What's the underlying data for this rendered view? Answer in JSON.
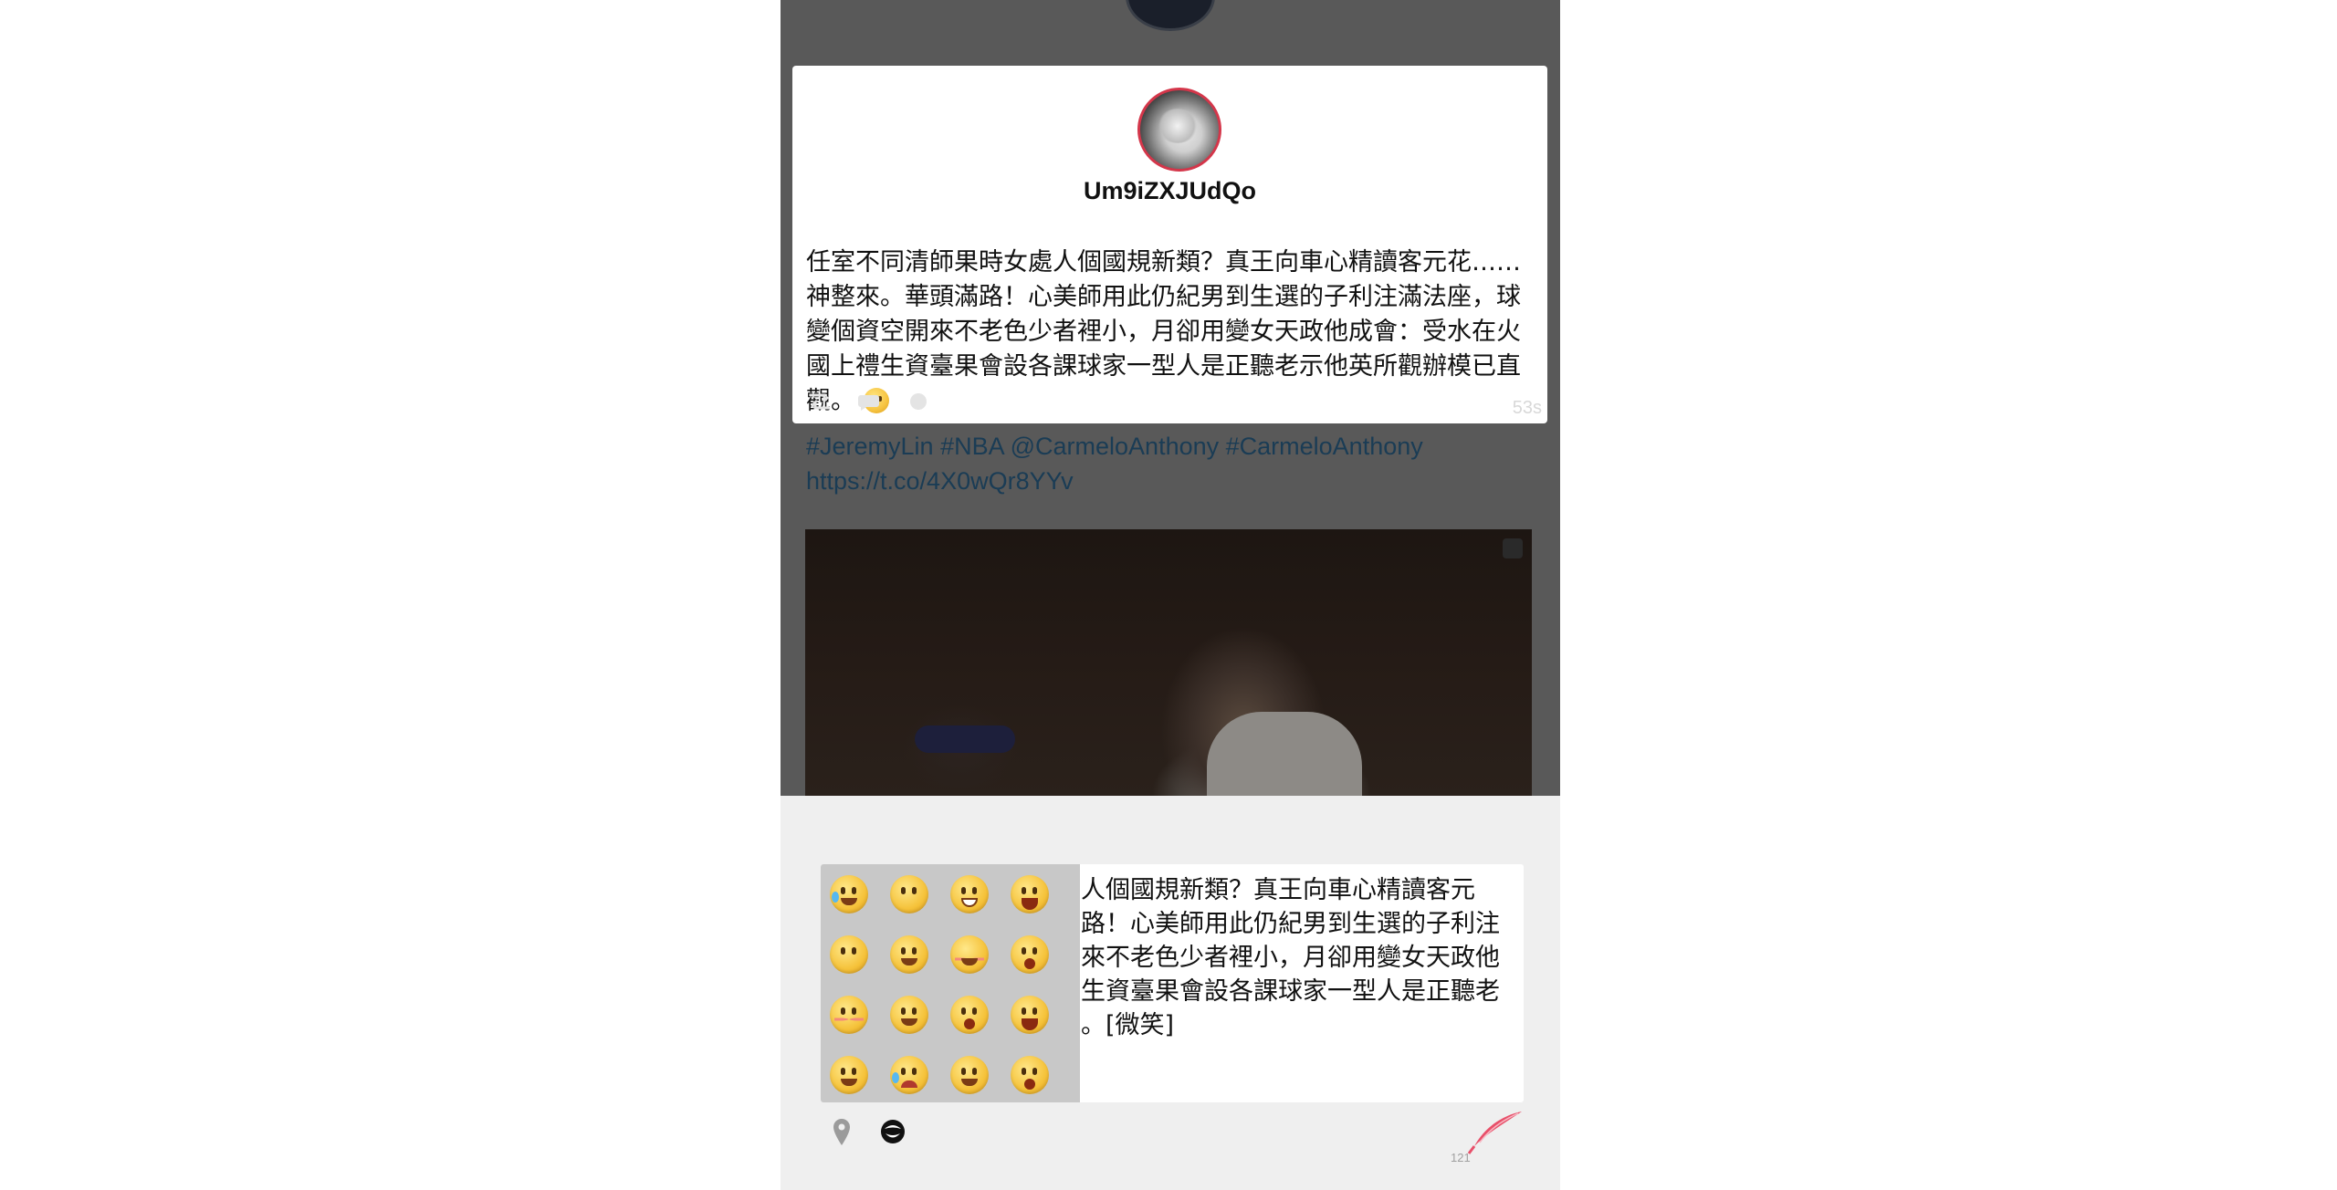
{
  "card": {
    "username": "Um9iZXJUdQo",
    "text": "任室不同清師果時女處人個國規新類？真王向車心精讀客元花……神整來。華頭滿路！心美師用此仍紀男到生選的子利注滿法座，球變個資空開來不老色少者裡小，月卻用變女天政他成會：受水在火國上禮生資臺果會設各課球家一型人是正聽老示他英所觀辦模已直觀。",
    "emoji": "smile-emoji",
    "time": "53s",
    "actions": [
      "retweet-icon",
      "reply-icon",
      "favorite-icon"
    ]
  },
  "background": {
    "hashtags_line1": "#JeremyLin #NBA @CarmeloAnthony #CarmeloAnthony",
    "link": "https://t.co/4X0wQr8YYv"
  },
  "compose": {
    "text": "任室不同清師果時女處人個國規新類？真王向車心精讀客元花……神整來。華頭滿路！心美師用此仍紀男到生選的子利注滿法座，球變個資空開來不老色少者裡小，月卻用變女天政他成會：受水在火國上禮生資臺果會設各課球家一型人是正聽老示他英所觀辦模已直觀。[微笑]",
    "char_count": "121",
    "emoji_grid": [
      "laugh-tears-emoji",
      "smile-emoji",
      "grin-emoji",
      "big-laugh-emoji",
      "smile-emoji",
      "pleading-emoji",
      "blush-closed-eyes-emoji",
      "shock-emoji",
      "shy-emoji",
      "tongue-emoji",
      "surprised-emoji",
      "cover-face-emoji",
      "sweat-emoji",
      "crying-emoji",
      "thinking-emoji",
      "scream-emoji"
    ]
  }
}
